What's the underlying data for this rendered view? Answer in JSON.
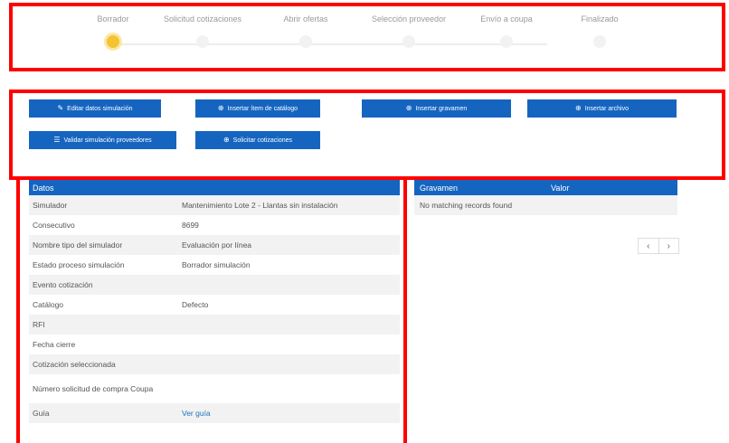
{
  "stepper": {
    "steps": [
      {
        "label": "Borrador"
      },
      {
        "label": "Solicitud cotizaciones"
      },
      {
        "label": "Abrir ofertas"
      },
      {
        "label": "Selección proveedor"
      },
      {
        "label": "Envío a coupa"
      },
      {
        "label": "Finalizado"
      }
    ],
    "active_step": "Borrador",
    "active_color": "#f4c430"
  },
  "actions": {
    "edit": {
      "label": "Editar datos simulación",
      "icon": "edit-icon"
    },
    "insert_item": {
      "label": "Insertar ítem de catálogo",
      "icon": "plus-circle-icon"
    },
    "insert_tax": {
      "label": "Insertar gravamen",
      "icon": "plus-circle-icon"
    },
    "insert_file": {
      "label": "Insertar archivo",
      "icon": "plus-circle-icon"
    },
    "validate": {
      "label": "Validar simulación proveedores",
      "icon": "list-check-icon"
    },
    "request_quotes": {
      "label": "Solicitar cotizaciones",
      "icon": "plus-circle-outline-icon"
    },
    "button_color": "#1565c0"
  },
  "datos": {
    "header": "Datos",
    "rows": [
      {
        "key": "Simulador",
        "value": "Mantenimiento Lote 2 - Llantas sin instalación"
      },
      {
        "key": "Consecutivo",
        "value": "8699"
      },
      {
        "key": "Nombre tipo del simulador",
        "value": "Evaluación por línea"
      },
      {
        "key": "Estado proceso simulación",
        "value": "Borrador simulación"
      },
      {
        "key": "Evento cotización",
        "value": ""
      },
      {
        "key": "Catálogo",
        "value": "Defecto"
      },
      {
        "key": "RFI",
        "value": ""
      },
      {
        "key": "Fecha cierre",
        "value": ""
      },
      {
        "key": "Cotización seleccionada",
        "value": ""
      },
      {
        "key": "Número solicitud de compra Coupa",
        "value": ""
      },
      {
        "key": "Guía",
        "value": "Ver guía"
      }
    ]
  },
  "gravamen": {
    "col_gravamen": "Gravamen",
    "col_valor": "Valor",
    "empty_message": "No matching records found",
    "pager_prev": "‹",
    "pager_next": "›"
  },
  "highlight_color": "#ff0000"
}
